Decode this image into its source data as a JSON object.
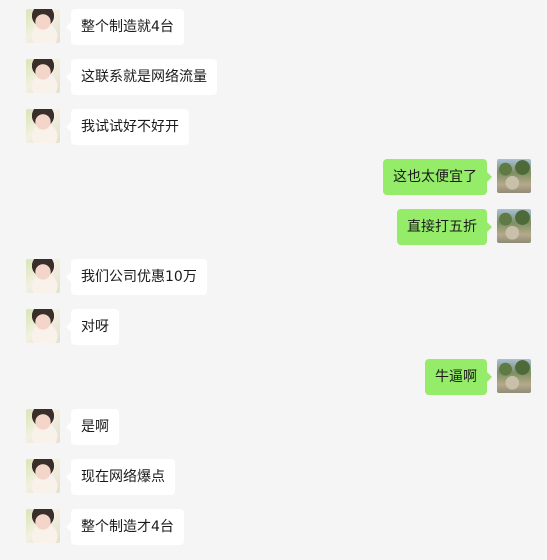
{
  "messages": [
    {
      "side": "left",
      "text": "整个制造就4台",
      "avatar": "avatar-girl"
    },
    {
      "side": "left",
      "text": "这联系就是网络流量",
      "avatar": "avatar-girl"
    },
    {
      "side": "left",
      "text": "我试试好不好开",
      "avatar": "avatar-girl"
    },
    {
      "side": "right",
      "text": "这也太便宜了",
      "avatar": "avatar-landscape"
    },
    {
      "side": "right",
      "text": "直接打五折",
      "avatar": "avatar-landscape"
    },
    {
      "side": "left",
      "text": "我们公司优惠10万",
      "avatar": "avatar-girl"
    },
    {
      "side": "left",
      "text": "对呀",
      "avatar": "avatar-girl"
    },
    {
      "side": "right",
      "text": "牛逼啊",
      "avatar": "avatar-landscape"
    },
    {
      "side": "left",
      "text": "是啊",
      "avatar": "avatar-girl"
    },
    {
      "side": "left",
      "text": "现在网络爆点",
      "avatar": "avatar-girl"
    },
    {
      "side": "left",
      "text": "整个制造才4台",
      "avatar": "avatar-girl"
    }
  ],
  "colors": {
    "background": "#f5f5f5",
    "incoming_bubble": "#ffffff",
    "outgoing_bubble": "#95ec69",
    "text": "#1a1a1a"
  }
}
